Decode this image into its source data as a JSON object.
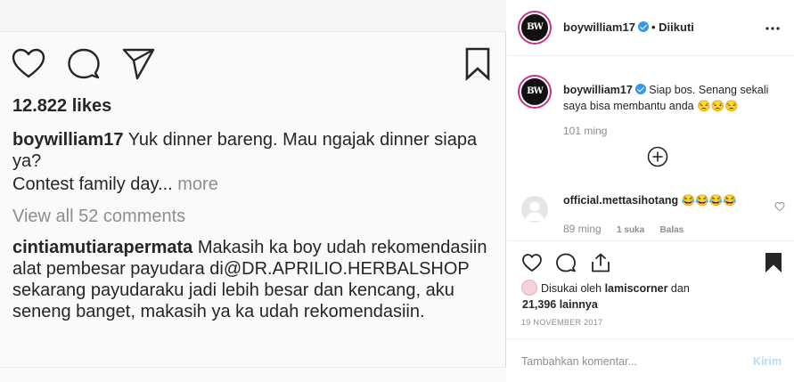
{
  "left": {
    "likes": "12.822 likes",
    "caption": {
      "user": "boywilliam17",
      "text": " Yuk dinner bareng. Mau ngajak dinner siapa ya?"
    },
    "contest": "Contest family day...",
    "more": "more",
    "view_all": "View all 52 comments",
    "comment": {
      "user": "cintiamutiarapermata",
      "text": " Makasih ka boy udah rekomendasiin alat pembesar payudara di@DR.APRILIO.HERBALSHOP  sekarang payudaraku jadi lebih besar dan kencang, aku seneng banget, makasih ya ka udah rekomendasiin."
    },
    "icons": [
      "heart-icon",
      "comment-icon",
      "share-icon",
      "bookmark-icon"
    ]
  },
  "right": {
    "header": {
      "username": "boywilliam17",
      "follow_status": "• Diikuti",
      "avatar_text": "BW"
    },
    "reply_comment": {
      "user": "boywilliam17",
      "text": " Siap bos. Senang sekali saya bisa membantu anda 😒😒😒",
      "time": "101 ming"
    },
    "second_comment": {
      "user": "official.mettasihotang",
      "text": " 😂😂😂😂",
      "time": "89 ming",
      "likes": "1 suka",
      "reply": "Balas"
    },
    "liked_by": {
      "prefix": "Disukai oleh ",
      "user": "lamiscorner",
      "mid": " dan",
      "count": "21,396 lainnya"
    },
    "date": "19 NOVEMBER 2017",
    "add_comment": {
      "placeholder": "Tambahkan komentar...",
      "post": "Kirim"
    }
  },
  "colors": {
    "accent_blue": "#3897f0",
    "post_disabled": "#b2dffc",
    "muted": "#8e8e8e",
    "text": "#262626"
  }
}
